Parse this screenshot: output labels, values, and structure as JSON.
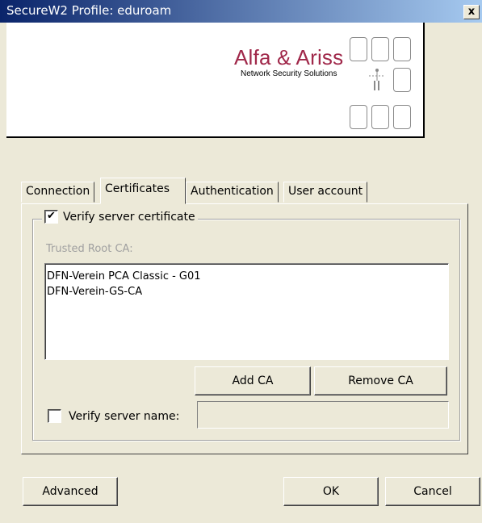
{
  "window": {
    "title": "SecureW2 Profile: eduroam",
    "close_label": "x"
  },
  "banner": {
    "logo_title": "Alfa & Ariss",
    "logo_subtitle": "Network Security Solutions"
  },
  "tabs": [
    {
      "label": "Connection",
      "active": false
    },
    {
      "label": "Certificates",
      "active": true
    },
    {
      "label": "Authentication",
      "active": false
    },
    {
      "label": "User account",
      "active": false
    }
  ],
  "certificates": {
    "verify_server_certificate": {
      "label": "Verify server certificate",
      "checked": true
    },
    "trusted_root_ca_label": "Trusted Root CA:",
    "trusted_root_ca_items": [
      "DFN-Verein PCA Classic - G01",
      "DFN-Verein-GS-CA"
    ],
    "add_ca_label": "Add CA",
    "remove_ca_label": "Remove CA",
    "verify_server_name": {
      "label": "Verify server name:",
      "checked": false,
      "value": ""
    }
  },
  "footer": {
    "advanced_label": "Advanced",
    "ok_label": "OK",
    "cancel_label": "Cancel"
  },
  "icons": {
    "checkmark": "✔"
  },
  "colors": {
    "titlebar": "#0a246a",
    "dialog_bg": "#ece9d8",
    "logo_accent": "#a0284a"
  }
}
